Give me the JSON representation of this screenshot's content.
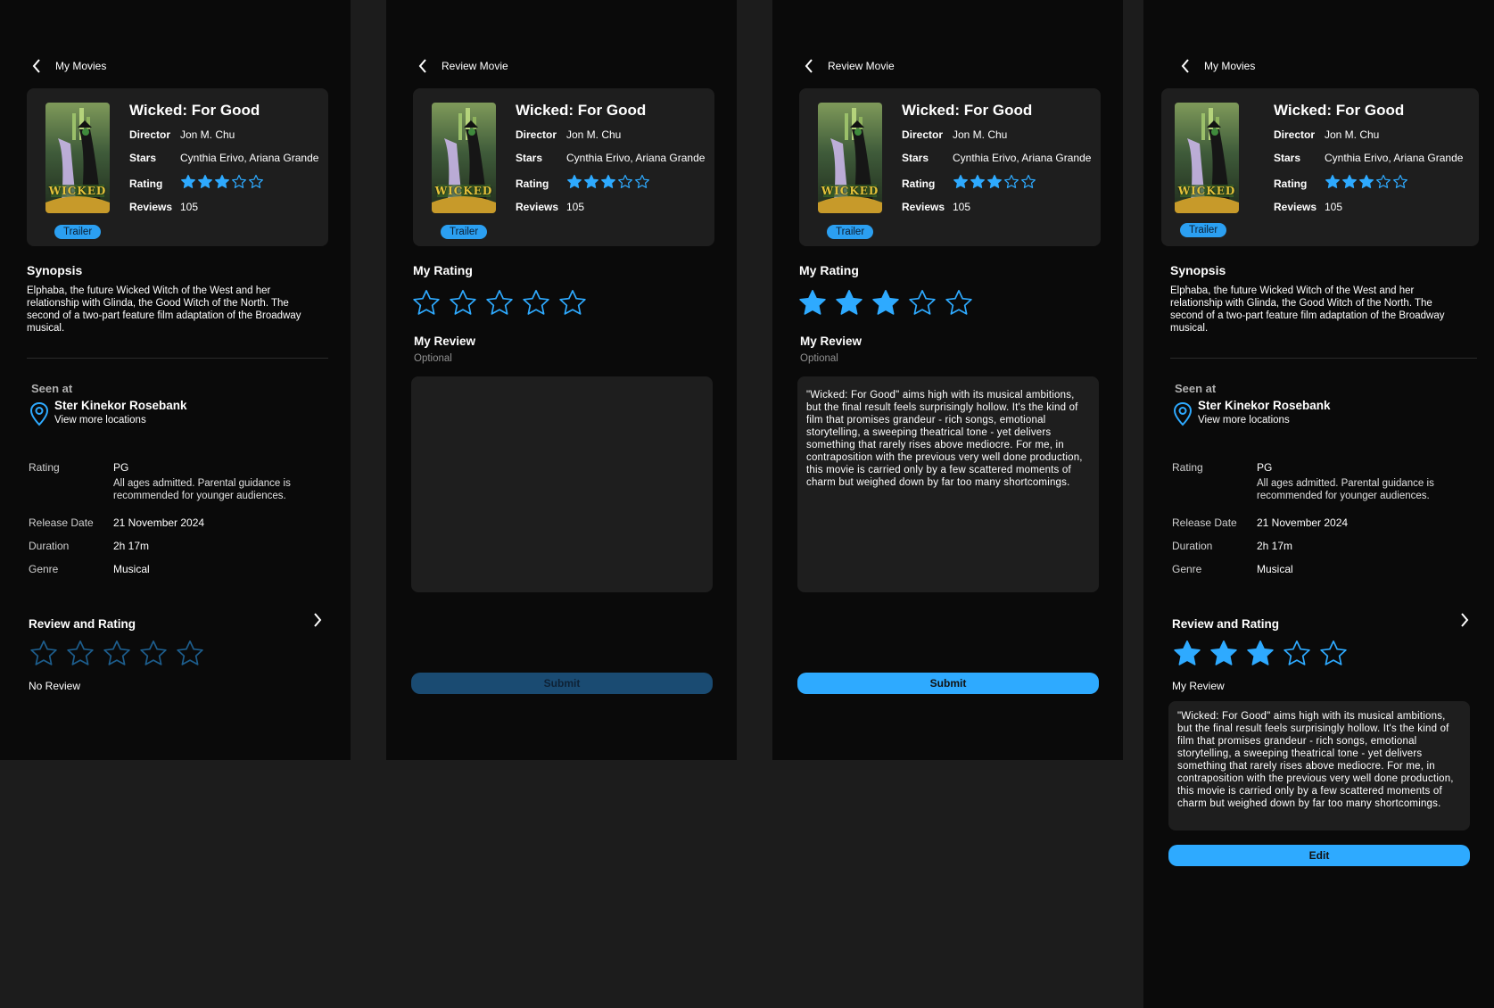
{
  "colors": {
    "accent": "#2eaaff",
    "screen_bg": "#0a0a0a",
    "card_bg": "#1e1e1e",
    "canvas_bg": "#1c1c1c"
  },
  "movie": {
    "title": "Wicked: For Good",
    "director_label": "Director",
    "director": "Jon M. Chu",
    "stars_label": "Stars",
    "stars": "Cynthia Erivo, Ariana Grande",
    "rating_label": "Rating",
    "rating_stars": 3,
    "rating_max": 5,
    "reviews_label": "Reviews",
    "reviews": "105",
    "trailer": "Trailer"
  },
  "screens": {
    "details": {
      "header": "My Movies",
      "synopsis_title": "Synopsis",
      "synopsis": "Elphaba, the future Wicked Witch of the West and her relationship with Glinda, the Good Witch of the North. The second of a two-part feature film adaptation of the Broadway musical.",
      "seen_at_label": "Seen at",
      "cinema": "Ster Kinekor Rosebank",
      "more_locations": "View more locations",
      "info": {
        "rating_label": "Rating",
        "rating_value": "PG",
        "rating_note": "All ages admitted. Parental guidance is recommended for younger audiences.",
        "release_label": "Release Date",
        "release_value": "21 November 2024",
        "duration_label": "Duration",
        "duration_value": "2h 17m",
        "genre_label": "Genre",
        "genre_value": "Musical"
      },
      "review_rating_title": "Review and Rating",
      "no_review": "No Review",
      "my_review_label": "My Review",
      "edit_button": "Edit"
    },
    "review": {
      "header": "Review Movie",
      "my_rating_title": "My Rating",
      "my_review_title": "My Review",
      "optional": "Optional",
      "submit": "Submit",
      "review_text": "\"Wicked: For Good\" aims high with its musical ambitions, but the final result feels surprisingly hollow. It's the kind of film that promises grandeur - rich songs, emotional storytelling, a sweeping theatrical tone - yet delivers something that rarely rises above mediocre. For me, in contraposition with the previous very well done production, this movie is carried only by a few scattered moments of charm but weighed down by far too many shortcomings."
    }
  },
  "user_rating": 3,
  "poster_art_text": "WICKED"
}
